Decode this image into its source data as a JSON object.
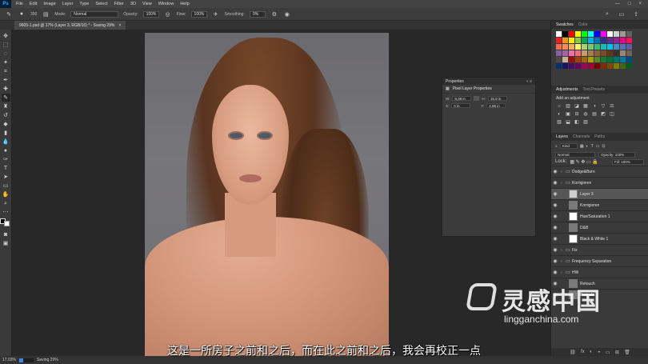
{
  "menubar": {
    "logo": "Ps",
    "items": [
      "File",
      "Edit",
      "Image",
      "Layer",
      "Type",
      "Select",
      "Filter",
      "3D",
      "View",
      "Window",
      "Help"
    ],
    "win_controls": [
      "—",
      "□",
      "×"
    ]
  },
  "options": {
    "brush_size": "300",
    "mode_label": "Mode:",
    "mode_value": "Normal",
    "opacity_label": "Opacity:",
    "opacity_value": "100%",
    "flow_label": "Flow:",
    "flow_value": "100%",
    "smoothing_label": "Smoothing:",
    "smoothing_value": "0%"
  },
  "document": {
    "tab_title": "9605-1.psd @ 17% (Layer 3, RGB/16) * - Saving 29%",
    "tab_close": "×"
  },
  "properties": {
    "title": "Properties",
    "subtitle": "Pixel Layer Properties",
    "w_label": "W:",
    "w_value": "9,38 in",
    "h_label": "H:",
    "h_value": "15,9 in",
    "x_label": "X:",
    "x_value": "0 in",
    "y_label": "Y:",
    "y_value": "2,88 in",
    "controls": "«  ≡"
  },
  "swatches": {
    "tabs": [
      "Swatches",
      "Color"
    ],
    "colors": [
      "#ffffff",
      "#000000",
      "#ff0000",
      "#ffff00",
      "#00ff00",
      "#00ffff",
      "#0000ff",
      "#ff00ff",
      "#ffffff",
      "#d0d0d0",
      "#9a9a9a",
      "#606060",
      "#ed1c24",
      "#f7941d",
      "#fff200",
      "#8dc63f",
      "#00a651",
      "#00aeef",
      "#0072bc",
      "#2e3192",
      "#662d91",
      "#92278f",
      "#ec008c",
      "#ed145b",
      "#f26c4f",
      "#f68e56",
      "#fbaf5d",
      "#fff568",
      "#acd373",
      "#7cc576",
      "#3bb878",
      "#1abbb4",
      "#00bff3",
      "#438ccb",
      "#5574b9",
      "#605ca8",
      "#8560a8",
      "#a763a8",
      "#f06eaa",
      "#f26d7d",
      "#c69c6d",
      "#a67c52",
      "#8c6239",
      "#754c24",
      "#603913",
      "#362f2d",
      "#998675",
      "#736357",
      "#534741",
      "#c7b299",
      "#9e0b0f",
      "#a0410d",
      "#a36209",
      "#aba000",
      "#598527",
      "#1a7b30",
      "#007236",
      "#00746b",
      "#0076a3",
      "#004a80",
      "#003471",
      "#1b1464",
      "#440e62",
      "#630460",
      "#9e005d",
      "#9e0039",
      "#790000",
      "#7b2e00",
      "#7d4900",
      "#827b00",
      "#406618",
      "#005e20"
    ]
  },
  "adjustments": {
    "tabs": [
      "Adjustments",
      "Tool Presets"
    ],
    "title": "Add an adjustment",
    "icons": [
      "☼",
      "▥",
      "◪",
      "▦",
      "◑",
      "▽",
      "⚖",
      "◐",
      "▣",
      "⊟",
      "◍",
      "▤",
      "◩",
      "◫",
      "▧",
      "⬓",
      "◧",
      "▨"
    ]
  },
  "layers": {
    "tabs": [
      "Layers",
      "Channels",
      "Paths"
    ],
    "filter_kind": "Kind",
    "blend_mode": "Normal",
    "opacity": "Opacity: 100%",
    "lock": "Lock:",
    "fill": "Fill: 100%",
    "rows": [
      {
        "name": "Dodge&Burn",
        "kind": "group",
        "selected": false
      },
      {
        "name": "Korrigieren",
        "kind": "group",
        "selected": false
      },
      {
        "name": "Layer 3",
        "kind": "layer",
        "selected": true
      },
      {
        "name": "Korrigieren",
        "kind": "layer",
        "selected": false
      },
      {
        "name": "Hue/Saturation 1",
        "kind": "adj",
        "selected": false
      },
      {
        "name": "D&B",
        "kind": "layer",
        "selected": false
      },
      {
        "name": "Black & White 1",
        "kind": "adj",
        "selected": false
      },
      {
        "name": "Fix",
        "kind": "group",
        "selected": false
      },
      {
        "name": "Frequency Separation",
        "kind": "group",
        "selected": false
      },
      {
        "name": "HW",
        "kind": "group",
        "selected": false
      },
      {
        "name": "Retouch",
        "kind": "layer",
        "selected": false
      },
      {
        "name": "Portrait",
        "kind": "layer",
        "selected": false
      }
    ],
    "footer_icons": [
      "⛓",
      "fx",
      "◐",
      "◒",
      "▭",
      "⊞",
      "🗑"
    ]
  },
  "status": {
    "zoom": "17,03%",
    "saving_label": "Saving 29%",
    "progress": 0.29
  },
  "subtitle": "这是一所房子之前和之后，而在此之前和之后，我会再校正一点",
  "watermark": {
    "name": "灵感中国",
    "url": "lingganchina.com"
  }
}
